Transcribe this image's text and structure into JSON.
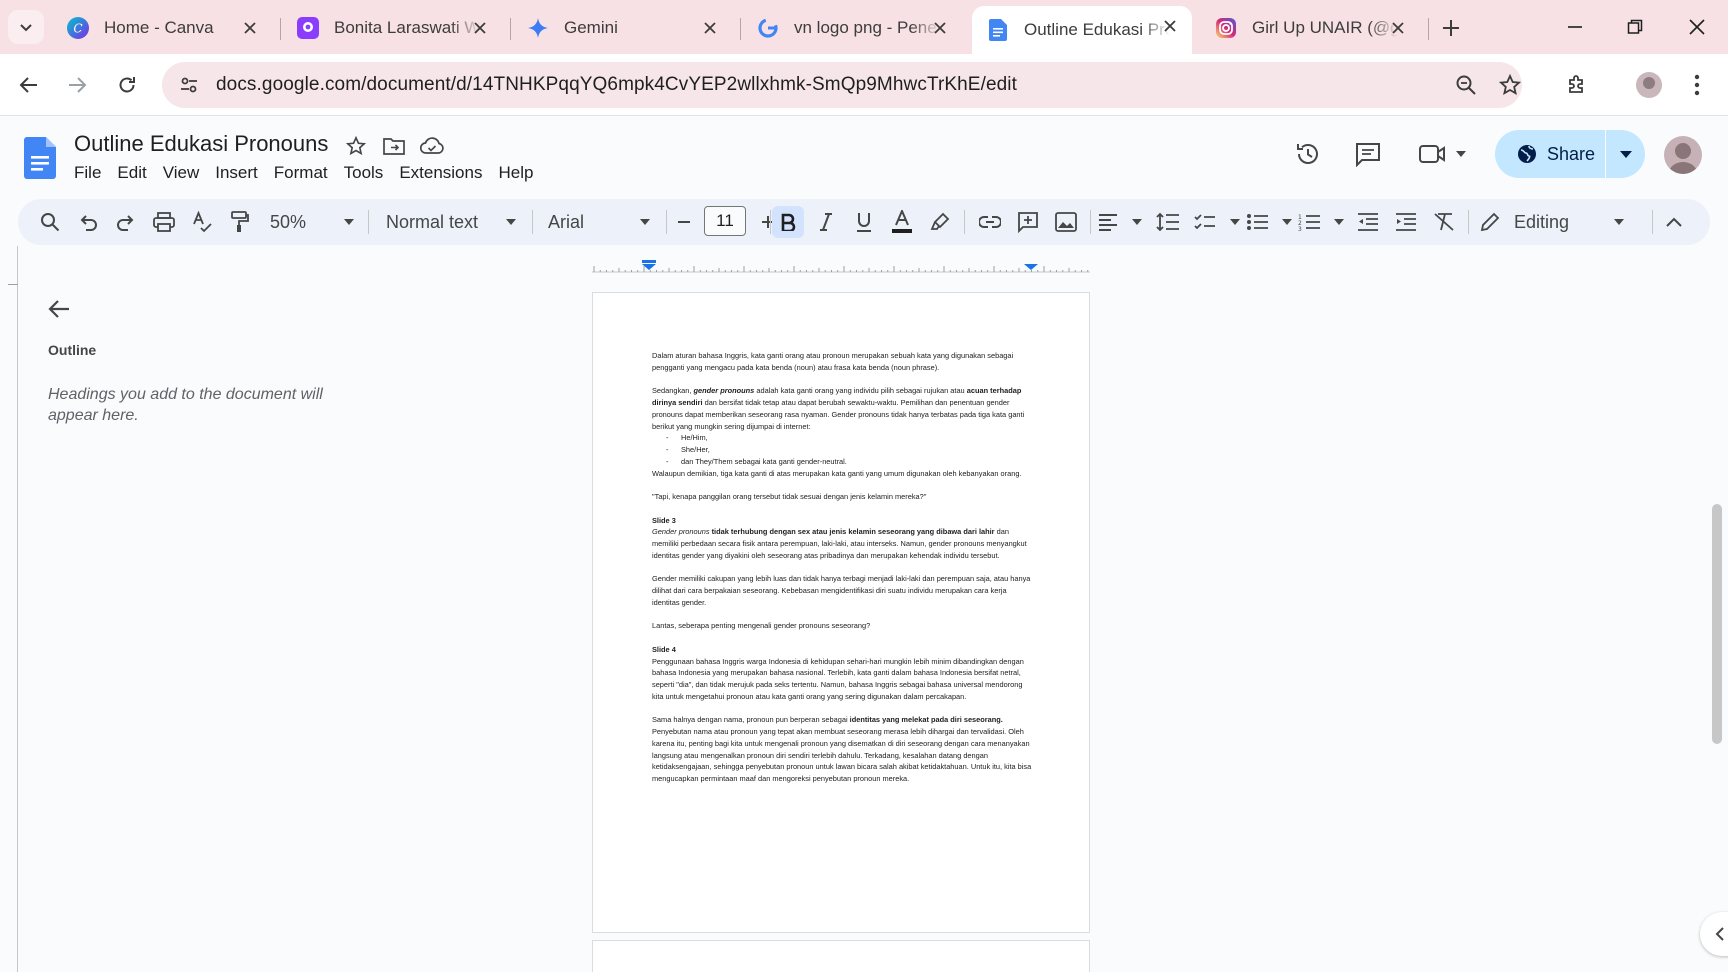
{
  "browser": {
    "tabs": [
      {
        "title": "Home - Canva",
        "icon": "canva-icon"
      },
      {
        "title": "Bonita Laraswati W",
        "icon": "app-icon"
      },
      {
        "title": "Gemini",
        "icon": "gemini-icon"
      },
      {
        "title": "vn logo png - Pene",
        "icon": "google-icon"
      },
      {
        "title": "Outline Edukasi Pro",
        "icon": "docs-icon",
        "active": true
      },
      {
        "title": "Girl Up UNAIR (@g",
        "icon": "instagram-icon"
      }
    ],
    "url": "docs.google.com/document/d/14TNHKPqqYQ6mpk4CvYEP2wllxhmk-SmQp9MhwcTrKhE/edit"
  },
  "doc": {
    "title": "Outline Edukasi Pronouns",
    "menu": [
      "File",
      "Edit",
      "View",
      "Insert",
      "Format",
      "Tools",
      "Extensions",
      "Help"
    ],
    "share_label": "Share"
  },
  "format_toolbar": {
    "zoom": "50%",
    "style": "Normal text",
    "font": "Arial",
    "font_size": "11",
    "mode": "Editing"
  },
  "outline": {
    "label": "Outline",
    "hint": "Headings you add to the document will appear here."
  },
  "page": {
    "p1": "Dalam aturan bahasa Inggris, kata ganti orang atau pronoun merupakan sebuah kata yang digunakan sebagai pengganti yang mengacu pada kata benda (noun) atau frasa kata benda (noun phrase).",
    "p2a": "Sedangkan, ",
    "p2b": "gender pronouns",
    "p2c": " adalah kata ganti orang yang individu pilih sebagai rujukan atau ",
    "p2d": "acuan terhadap dirinya sendiri",
    "p2e": " dan bersifat tidak tetap atau dapat berubah sewaktu-waktu. Pemilihan dan penentuan gender pronouns dapat memberikan seseorang rasa nyaman. Gender pronouns tidak hanya terbatas pada tiga kata ganti berikut yang mungkin sering dijumpai di internet:",
    "list": [
      "He/Him,",
      "She/Her,",
      "dan They/Them sebagai kata ganti gender-neutral."
    ],
    "p3": "Walaupun demikian, tiga kata ganti di atas merupakan kata ganti yang umum digunakan oleh kebanyakan orang.",
    "p4": "\"Tapi, kenapa panggilan orang tersebut tidak sesuai dengan jenis kelamin mereka?\"",
    "slide3": "Slide 3",
    "p5a": "Gender pronouns ",
    "p5b": "tidak terhubung dengan sex atau jenis kelamin seseorang yang dibawa dari lahir",
    "p5c": " dan memiliki perbedaan secara fisik antara perempuan, laki-laki, atau interseks. Namun, gender pronouns menyangkut identitas gender yang diyakini oleh seseorang atas pribadinya dan merupakan kehendak individu tersebut.",
    "p6": "Gender memiliki cakupan yang lebih luas dan tidak hanya terbagi menjadi laki-laki dan perempuan saja, atau hanya dilihat dari cara berpakaian seseorang. Kebebasan mengidentifikasi diri suatu individu merupakan cara kerja identitas gender.",
    "p7": "Lantas, seberapa penting mengenali gender pronouns seseorang?",
    "slide4": "Slide 4",
    "p8": "Penggunaan bahasa Inggris warga Indonesia di kehidupan sehari-hari mungkin lebih minim dibandingkan dengan bahasa Indonesia yang merupakan bahasa nasional. Terlebih, kata ganti dalam bahasa Indonesia bersifat netral, seperti \"dia\", dan tidak merujuk pada seks tertentu. Namun, bahasa Inggris sebagai bahasa universal mendorong kita untuk mengetahui pronoun atau kata ganti orang yang sering digunakan dalam percakapan.",
    "p9a": "Sama halnya dengan nama, pronoun pun berperan sebagai ",
    "p9b": "identitas yang melekat pada diri seseorang.",
    "p9c": " Penyebutan nama atau pronoun yang tepat akan membuat seseorang merasa lebih dihargai dan tervalidasi. Oleh karena itu, penting bagi kita untuk mengenali pronoun yang disematkan di diri seseorang dengan cara menanyakan langsung atau mengenalkan pronoun diri sendiri terlebih dahulu. Terkadang, kesalahan datang dengan ketidaksengajaan, sehingga penyebutan pronoun untuk lawan bicara salah akibat ketidaktahuan. Untuk itu, kita bisa mengucapkan permintaan maaf dan mengoreksi penyebutan pronoun mereka."
  },
  "colors": {
    "tab_strip": "#f7e1e5",
    "share_button": "#c2e7ff",
    "docs_blue": "#4285f4",
    "toolbar_bg": "#edf2fa"
  }
}
